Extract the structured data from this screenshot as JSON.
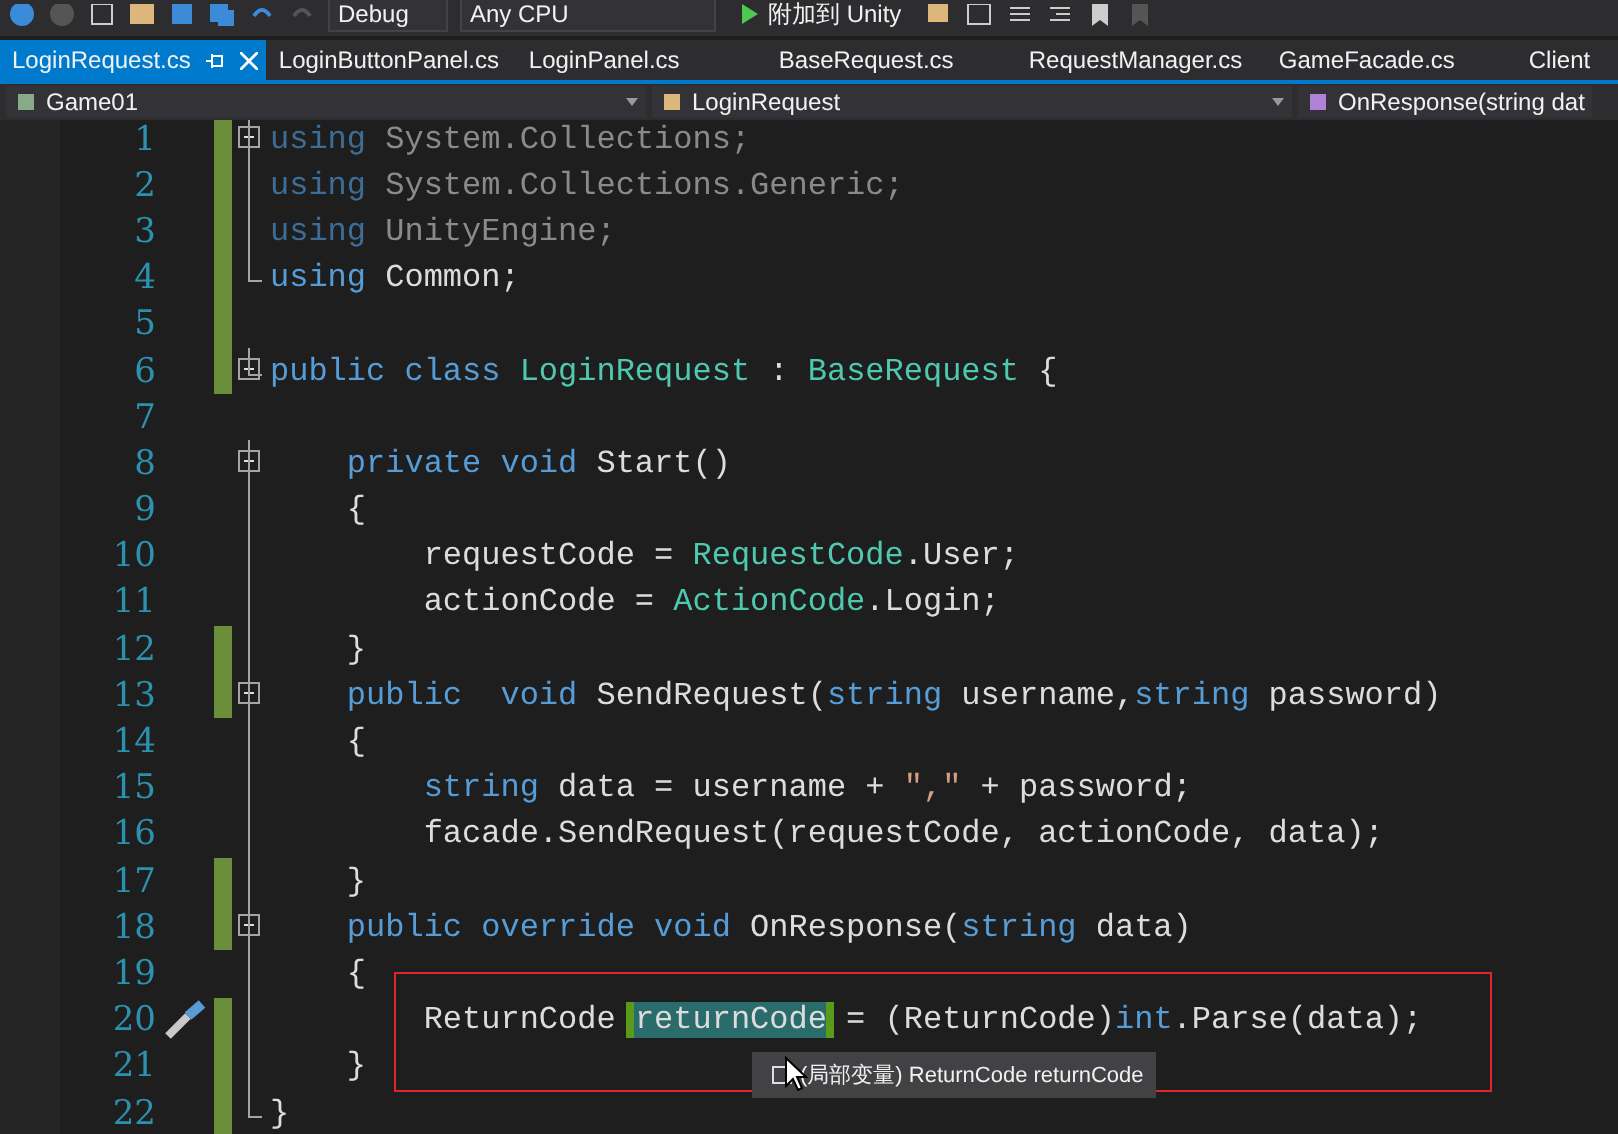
{
  "toolbar": {
    "configuration": "Debug",
    "platform": "Any CPU",
    "run_button": "附加到 Unity"
  },
  "tabs": [
    {
      "label": "LoginRequest.cs",
      "selected": true
    },
    {
      "label": "LoginButtonPanel.cs",
      "selected": false
    },
    {
      "label": "LoginPanel.cs",
      "selected": false
    },
    {
      "label": "BaseRequest.cs",
      "selected": false
    },
    {
      "label": "RequestManager.cs",
      "selected": false
    },
    {
      "label": "GameFacade.cs",
      "selected": false
    },
    {
      "label": "Client",
      "selected": false
    }
  ],
  "navigation": {
    "project": "Game01",
    "type": "LoginRequest",
    "member": "OnResponse(string dat"
  },
  "lines": [
    {
      "number": "1",
      "changed": true,
      "collapsible": true,
      "quick_action": false,
      "tokens": [
        {
          "kind": "faded-kw",
          "text": "using"
        },
        {
          "kind": "faded",
          "text": " System.Collections;"
        }
      ]
    },
    {
      "number": "2",
      "changed": true,
      "collapsible": false,
      "quick_action": false,
      "tokens": [
        {
          "kind": "faded-kw",
          "text": "using"
        },
        {
          "kind": "faded",
          "text": " System.Collections.Generic;"
        }
      ]
    },
    {
      "number": "3",
      "changed": true,
      "collapsible": false,
      "quick_action": false,
      "tokens": [
        {
          "kind": "faded-kw",
          "text": "using"
        },
        {
          "kind": "faded",
          "text": " UnityEngine;"
        }
      ]
    },
    {
      "number": "4",
      "changed": true,
      "collapsible": false,
      "quick_action": false,
      "tokens": [
        {
          "kind": "kw",
          "text": "using"
        },
        {
          "kind": "text",
          "text": " Common;"
        }
      ]
    },
    {
      "number": "5",
      "changed": true,
      "collapsible": false,
      "quick_action": false
    },
    {
      "number": "6",
      "changed": true,
      "collapsible": true,
      "quick_action": false,
      "tokens": [
        {
          "kind": "kw",
          "text": "public class"
        },
        {
          "kind": "type",
          "text": " LoginRequest"
        },
        {
          "kind": "text",
          "text": " : "
        },
        {
          "kind": "type",
          "text": "BaseRequest"
        },
        {
          "kind": "text",
          "text": " {"
        }
      ]
    },
    {
      "number": "7",
      "changed": false,
      "collapsible": false,
      "quick_action": false
    },
    {
      "number": "8",
      "changed": false,
      "collapsible": true,
      "quick_action": false,
      "tokens": [
        {
          "kind": "kw",
          "text": "    private void"
        },
        {
          "kind": "text",
          "text": " Start()"
        }
      ]
    },
    {
      "number": "9",
      "changed": false,
      "collapsible": false,
      "quick_action": false,
      "tokens": [
        {
          "kind": "text",
          "text": "    {"
        }
      ]
    },
    {
      "number": "10",
      "changed": false,
      "collapsible": false,
      "quick_action": false,
      "tokens": [
        {
          "kind": "text",
          "text": "        requestCode = "
        },
        {
          "kind": "type",
          "text": "RequestCode"
        },
        {
          "kind": "text",
          "text": ".User;"
        }
      ]
    },
    {
      "number": "11",
      "changed": false,
      "collapsible": false,
      "quick_action": false,
      "tokens": [
        {
          "kind": "text",
          "text": "        actionCode = "
        },
        {
          "kind": "type",
          "text": "ActionCode"
        },
        {
          "kind": "text",
          "text": ".Login;"
        }
      ]
    },
    {
      "number": "12",
      "changed": true,
      "collapsible": false,
      "quick_action": false,
      "tokens": [
        {
          "kind": "text",
          "text": "    }"
        }
      ]
    },
    {
      "number": "13",
      "changed": true,
      "collapsible": true,
      "quick_action": false,
      "tokens": [
        {
          "kind": "kw",
          "text": "    public  void"
        },
        {
          "kind": "text",
          "text": " SendRequest("
        },
        {
          "kind": "kw",
          "text": "string"
        },
        {
          "kind": "text",
          "text": " username,"
        },
        {
          "kind": "kw",
          "text": "string"
        },
        {
          "kind": "text",
          "text": " password)"
        }
      ]
    },
    {
      "number": "14",
      "changed": false,
      "collapsible": false,
      "quick_action": false,
      "tokens": [
        {
          "kind": "text",
          "text": "    {"
        }
      ]
    },
    {
      "number": "15",
      "changed": false,
      "collapsible": false,
      "quick_action": false,
      "tokens": [
        {
          "kind": "kw",
          "text": "        string"
        },
        {
          "kind": "text",
          "text": " data = username + "
        },
        {
          "kind": "str",
          "text": "\",\""
        },
        {
          "kind": "text",
          "text": " + password;"
        }
      ]
    },
    {
      "number": "16",
      "changed": false,
      "collapsible": false,
      "quick_action": false,
      "tokens": [
        {
          "kind": "text",
          "text": "        facade.SendRequest(requestCode, actionCode, data);"
        }
      ]
    },
    {
      "number": "17",
      "changed": true,
      "collapsible": false,
      "quick_action": false,
      "tokens": [
        {
          "kind": "text",
          "text": "    }"
        }
      ]
    },
    {
      "number": "18",
      "changed": true,
      "collapsible": true,
      "quick_action": false,
      "tokens": [
        {
          "kind": "kw",
          "text": "    public override void"
        },
        {
          "kind": "text",
          "text": " OnResponse("
        },
        {
          "kind": "kw",
          "text": "string"
        },
        {
          "kind": "text",
          "text": " data)"
        }
      ]
    },
    {
      "number": "19",
      "changed": false,
      "collapsible": false,
      "quick_action": false,
      "tokens": [
        {
          "kind": "text",
          "text": "    {"
        }
      ]
    },
    {
      "number": "20",
      "changed": true,
      "collapsible": false,
      "quick_action": true,
      "tokens": [
        {
          "kind": "text",
          "text": "        ReturnCode "
        },
        {
          "kind": "ref",
          "text": "returnCode"
        },
        {
          "kind": "text",
          "text": " = (ReturnCode)"
        },
        {
          "kind": "kw",
          "text": "int"
        },
        {
          "kind": "text",
          "text": ".Parse(data);"
        }
      ]
    },
    {
      "number": "21",
      "changed": true,
      "collapsible": false,
      "quick_action": false,
      "tokens": [
        {
          "kind": "text",
          "text": "    }"
        }
      ]
    },
    {
      "number": "22",
      "changed": true,
      "collapsible": false,
      "quick_action": false,
      "tokens": [
        {
          "kind": "text",
          "text": "}"
        }
      ]
    }
  ],
  "tooltip": {
    "kind_label": "(局部变量)",
    "signature": "ReturnCode returnCode"
  }
}
